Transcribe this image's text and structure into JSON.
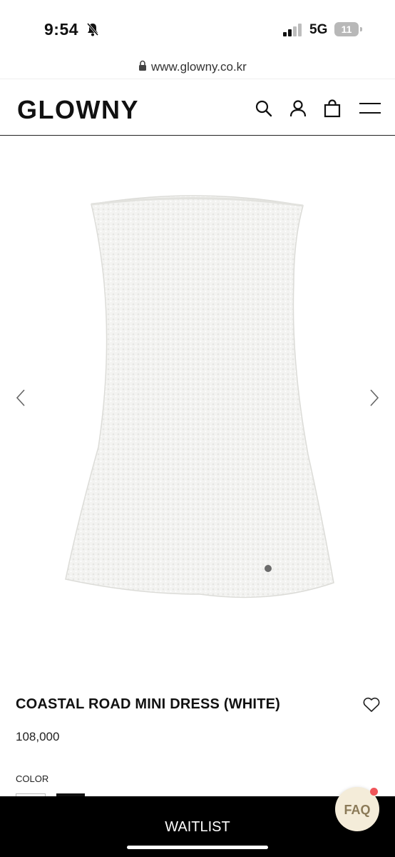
{
  "status_bar": {
    "time": "9:54",
    "network": "5G",
    "battery": "11",
    "icons": [
      "bell-slash-icon",
      "signal-icon",
      "battery-icon"
    ]
  },
  "browser": {
    "url": "www.glowny.co.kr",
    "icons": [
      "lock-icon"
    ]
  },
  "header": {
    "logo": "GLOWNY",
    "icons": [
      "search-icon",
      "user-icon",
      "bag-icon",
      "menu-icon"
    ]
  },
  "gallery": {
    "icons": [
      "chevron-left-icon",
      "chevron-right-icon"
    ],
    "image": "white strapless mini dress"
  },
  "product": {
    "name": "COASTAL ROAD MINI DRESS (WHITE)",
    "price": "108,000",
    "color_label": "COLOR",
    "colors": [
      "#ffffff",
      "#111111"
    ]
  },
  "bottom_bar": {
    "button_label": "WAITLIST",
    "faq_label": "FAQ"
  },
  "colors": {
    "background": "#ffffff",
    "text": "#111111",
    "bottom_bar": "#000000",
    "faq_bg": "#f4ecd9",
    "faq_text": "#8b7a58",
    "notification_dot": "#f0555a"
  }
}
